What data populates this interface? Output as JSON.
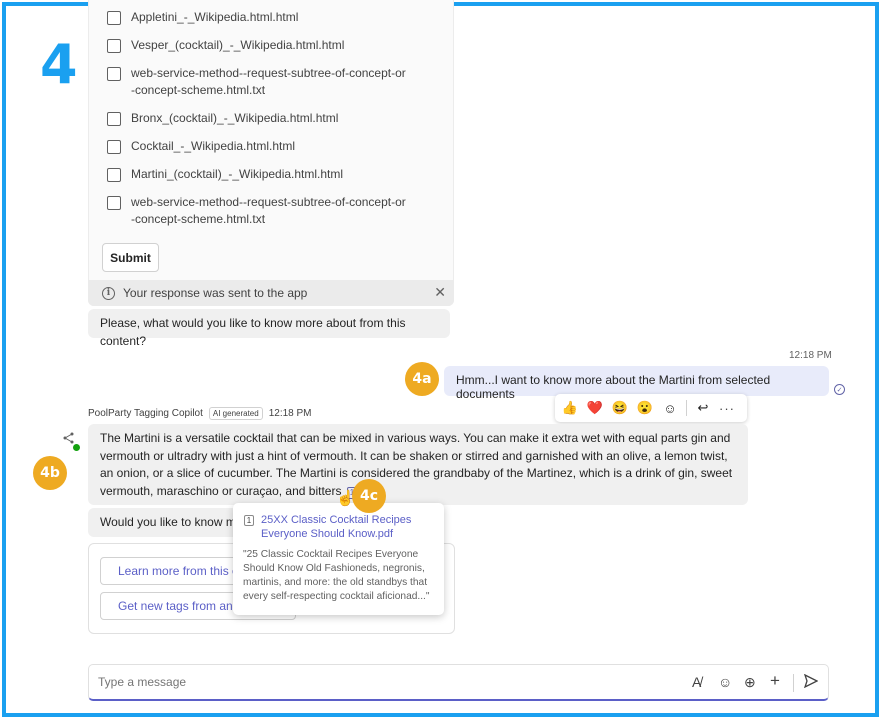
{
  "step_label": "4",
  "files": [
    {
      "name": "Appletini_-_Wikipedia.html.html"
    },
    {
      "name": "Vesper_(cocktail)_-_Wikipedia.html.html"
    },
    {
      "name": "web-service-method--request-subtree-of-concept-or-concept-scheme.html.txt"
    },
    {
      "name": "Bronx_(cocktail)_-_Wikipedia.html.html"
    },
    {
      "name": "Cocktail_-_Wikipedia.html.html"
    },
    {
      "name": "Martini_(cocktail)_-_Wikipedia.html.html"
    },
    {
      "name": "web-service-method--request-subtree-of-concept-or-concept-scheme.html.txt"
    }
  ],
  "submit_label": "Submit",
  "response_notice": "Your response was sent to the app",
  "bot_prompt": "Please, what would you like to know more about from this content?",
  "user_message": {
    "time": "12:18 PM",
    "text": "Hmm...I want to know more about the Martini from selected documents"
  },
  "badges": {
    "a": "4a",
    "b": "4b",
    "c": "4c"
  },
  "reactions": [
    "👍",
    "❤️",
    "😆",
    "😮",
    "☺"
  ],
  "bot_reply": {
    "sender": "PoolParty Tagging Copilot",
    "ai_tag": "AI generated",
    "time": "12:18 PM",
    "text": "The Martini is a versatile cocktail that can be mixed in various ways. You can make it extra wet with equal parts gin and vermouth or ultradry with just a hint of vermouth. It can be shaken or stirred and garnished with an olive, a lemon twist, an onion, or a slice of cucumber. The Martini is considered the grandbaby of the Martinez, which is a drink of gin, sweet vermouth, maraschino or curaçao, and bitters",
    "citation": "1"
  },
  "followup_prompt": "Would you like to know mo",
  "action_buttons": {
    "learn": "Learn more from this c",
    "tags": "Get new tags from and"
  },
  "citation_popup": {
    "number": "1",
    "title": "25XX Classic Cocktail Recipes Everyone Should Know.pdf",
    "snippet": "\"25 Classic Cocktail Recipes Everyone Should Know Old Fashioneds, negronis, martinis, and more: the old standbys that every self-respecting cocktail aficionad...\""
  },
  "compose": {
    "placeholder": "Type a message"
  }
}
